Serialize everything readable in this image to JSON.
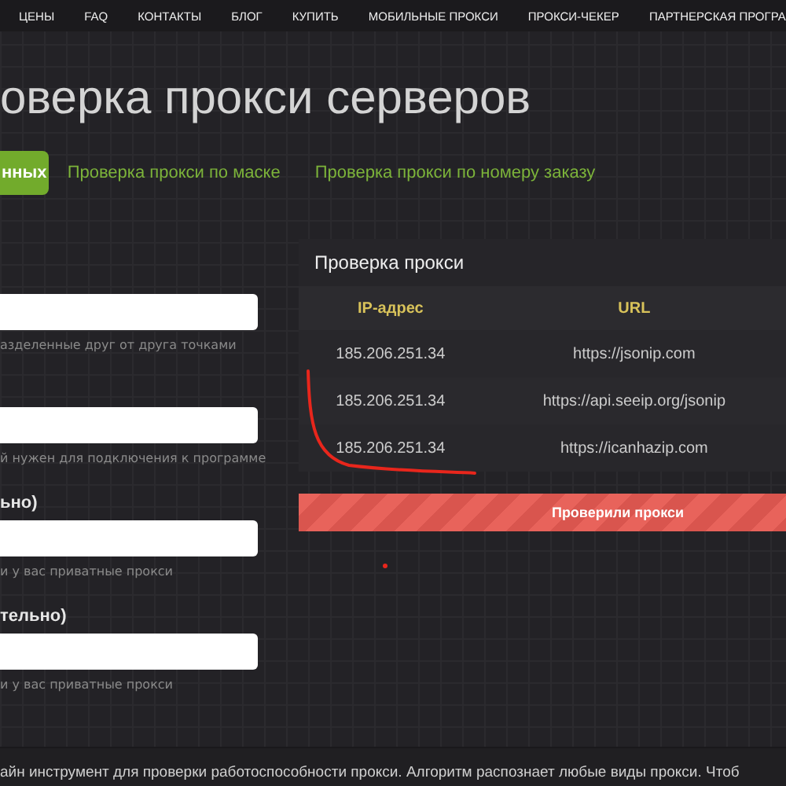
{
  "nav": {
    "items": [
      "ЦЕНЫ",
      "FAQ",
      "КОНТАКТЫ",
      "БЛОГ",
      "КУПИТЬ",
      "МОБИЛЬНЫЕ ПРОКСИ",
      "ПРОКСИ-ЧЕКЕР",
      "ПАРТНЕРСКАЯ ПРОГРА"
    ]
  },
  "title": "оверка прокси серверов",
  "tabs": [
    {
      "label": "нных",
      "selected": true
    },
    {
      "label": "Проверка прокси по маске",
      "selected": false
    },
    {
      "label": "Проверка прокси по номеру заказу",
      "selected": false
    }
  ],
  "form": {
    "fields": [
      {
        "hint": "азделенные друг от друга точками"
      },
      {
        "hint": "й нужен для подключения к программе"
      },
      {
        "label": "ьно)",
        "hint": "и у вас приватные прокси"
      },
      {
        "label": "тельно)",
        "hint": "и у вас приватные прокси"
      }
    ]
  },
  "checker": {
    "title": "Проверка прокси",
    "columns": [
      "IP-адрес",
      "URL"
    ],
    "rows": [
      [
        "185.206.251.34",
        "https://jsonip.com"
      ],
      [
        "185.206.251.34",
        "https://api.seeip.org/jsonip"
      ],
      [
        "185.206.251.34",
        "https://icanhazip.com"
      ]
    ],
    "progress": {
      "level": 1,
      "label": "Проверили прокси"
    }
  },
  "footer_text": "айн инструмент для проверки работоспособности прокси. Алгоритм распознает любые виды прокси. Чтоб"
}
